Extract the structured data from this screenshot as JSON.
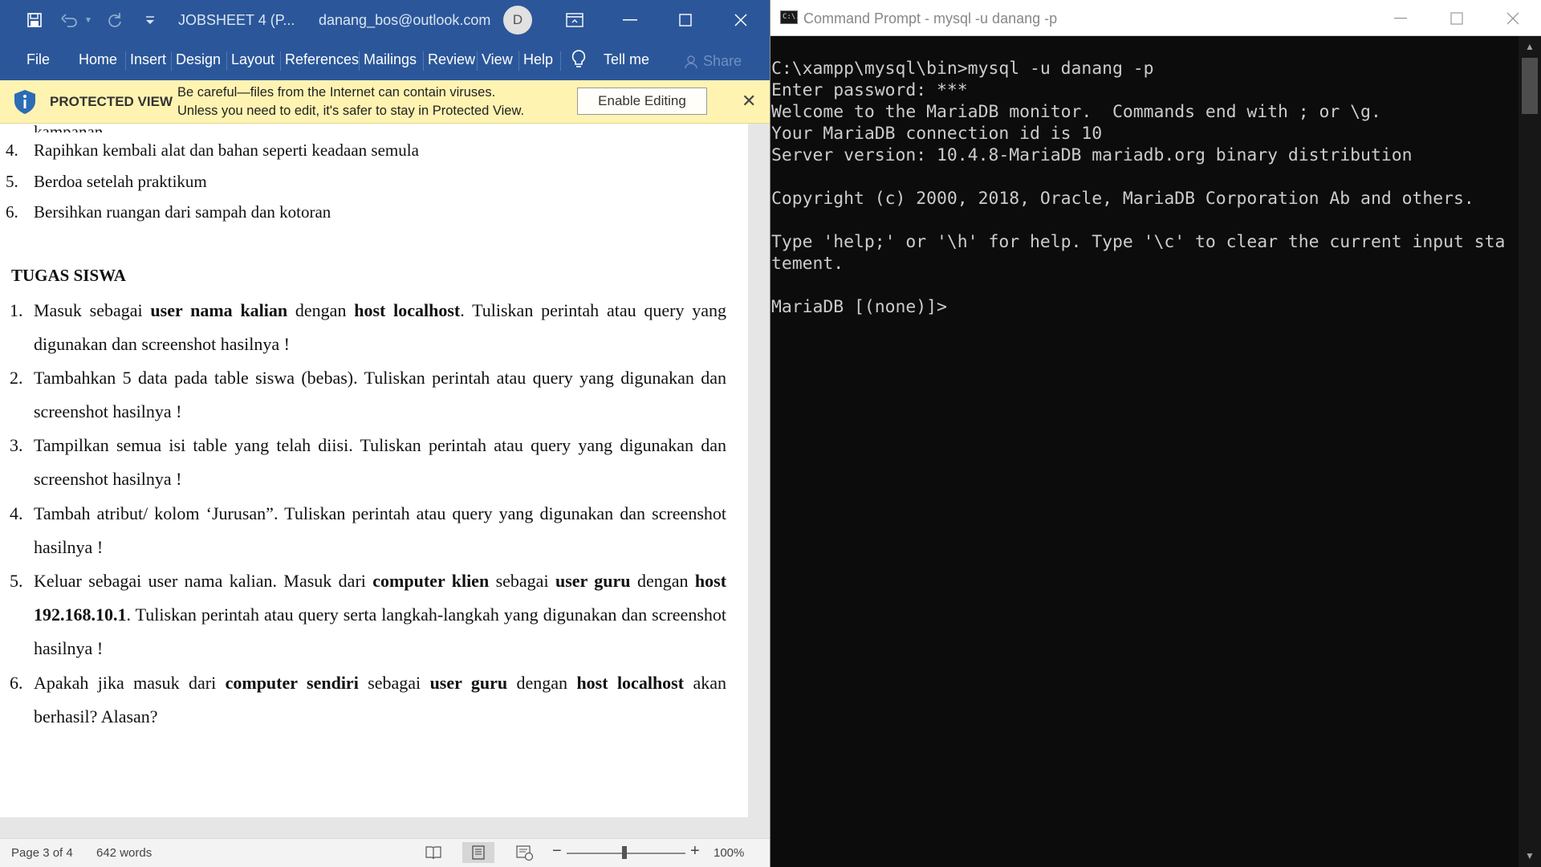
{
  "word": {
    "title": {
      "document_name": "JOBSHEET 4 (P...",
      "account": "danang_bos@outlook.com",
      "avatar_initial": "D"
    },
    "tabs": [
      "File",
      "Home",
      "Insert",
      "Design",
      "Layout",
      "References",
      "Mailings",
      "Review",
      "View",
      "Help"
    ],
    "tell_me": "Tell me",
    "share": "Share",
    "protected_view": {
      "title": "PROTECTED VIEW",
      "message_line1": "Be careful—files from the Internet can contain viruses.",
      "message_line2": "Unless you need to edit, it's safer to stay in Protected View.",
      "enable_button": "Enable Editing"
    },
    "document": {
      "cut_line": "kampanan",
      "procedure_items": [
        {
          "num": "4.",
          "text": "Rapihkan kembali alat dan bahan seperti keadaan semula"
        },
        {
          "num": "5.",
          "text": "Berdoa setelah praktikum"
        },
        {
          "num": "6.",
          "text": "Bersihkan ruangan dari sampah dan kotoran"
        }
      ],
      "heading": "TUGAS SISWA",
      "tasks": [
        {
          "num": "1.",
          "segments": [
            {
              "t": "Masuk sebagai ",
              "b": false
            },
            {
              "t": "user nama kalian",
              "b": true
            },
            {
              "t": " dengan ",
              "b": false
            },
            {
              "t": "host localhost",
              "b": true
            },
            {
              "t": ". Tuliskan perintah atau query yang digunakan dan screenshot hasilnya !",
              "b": false
            }
          ]
        },
        {
          "num": "2.",
          "segments": [
            {
              "t": "Tambahkan 5 data pada table siswa (bebas). Tuliskan perintah atau query yang digunakan dan screenshot hasilnya !",
              "b": false
            }
          ]
        },
        {
          "num": "3.",
          "segments": [
            {
              "t": "Tampilkan semua isi table yang telah diisi. Tuliskan perintah atau query yang digunakan dan screenshot hasilnya !",
              "b": false
            }
          ]
        },
        {
          "num": "4.",
          "segments": [
            {
              "t": "Tambah atribut/ kolom ‘Jurusan”. Tuliskan perintah atau query yang digunakan dan screenshot hasilnya !",
              "b": false
            }
          ]
        },
        {
          "num": "5.",
          "segments": [
            {
              "t": "Keluar sebagai user nama kalian. Masuk dari ",
              "b": false
            },
            {
              "t": "computer klien",
              "b": true
            },
            {
              "t": " sebagai ",
              "b": false
            },
            {
              "t": "user guru",
              "b": true
            },
            {
              "t": " dengan ",
              "b": false
            },
            {
              "t": "host 192.168.10.1",
              "b": true
            },
            {
              "t": ". Tuliskan perintah atau query serta langkah-langkah yang digunakan dan screenshot hasilnya !",
              "b": false
            }
          ]
        },
        {
          "num": "6.",
          "segments": [
            {
              "t": "Apakah jika masuk dari ",
              "b": false
            },
            {
              "t": "computer sendiri",
              "b": true
            },
            {
              "t": " sebagai ",
              "b": false
            },
            {
              "t": "user guru",
              "b": true
            },
            {
              "t": " dengan ",
              "b": false
            },
            {
              "t": "host localhost",
              "b": true
            },
            {
              "t": " akan berhasil? Alasan?",
              "b": false
            }
          ]
        }
      ]
    },
    "status": {
      "page": "Page 3 of 4",
      "words": "642 words",
      "zoom": "100%",
      "zoom_minus": "−",
      "zoom_plus": "+"
    },
    "colors": {
      "ribbon": "#2b579a",
      "protected_bar": "#fff3b2"
    }
  },
  "cmd": {
    "title": "Command Prompt - mysql  -u danang -p",
    "icon_text": "C:\\.",
    "console_lines": [
      "C:\\xampp\\mysql\\bin>mysql -u danang -p",
      "Enter password: ***",
      "Welcome to the MariaDB monitor.  Commands end with ; or \\g.",
      "Your MariaDB connection id is 10",
      "Server version: 10.4.8-MariaDB mariadb.org binary distribution",
      "",
      "Copyright (c) 2000, 2018, Oracle, MariaDB Corporation Ab and others.",
      "",
      "Type 'help;' or '\\h' for help. Type '\\c' to clear the current input sta",
      "tement.",
      "",
      "MariaDB [(none)]>"
    ],
    "colors": {
      "background": "#0c0c0c",
      "text": "#cccccc"
    }
  }
}
